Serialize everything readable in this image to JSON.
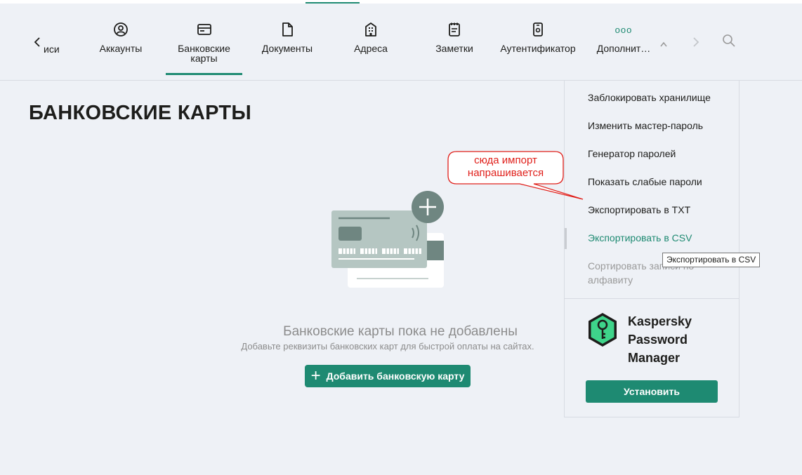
{
  "nav": {
    "partial_tab_label": "иси",
    "tabs": [
      {
        "label": "Аккаунты",
        "icon": "user-circle-icon"
      },
      {
        "label": "Банковские карты",
        "icon": "credit-card-icon"
      },
      {
        "label": "Документы",
        "icon": "document-icon"
      },
      {
        "label": "Адреса",
        "icon": "building-icon"
      },
      {
        "label": "Заметки",
        "icon": "notepad-icon"
      },
      {
        "label": "Аутентификатор",
        "icon": "phone-auth-icon"
      },
      {
        "label": "Дополнит…",
        "icon": "more-dots-icon",
        "dots": "ooo"
      }
    ]
  },
  "page": {
    "title": "БАНКОВСКИЕ КАРТЫ",
    "empty_title": "Банковские карты пока не добавлены",
    "empty_subtitle": "Добавьте реквизиты банковских карт для быстрой оплаты на сайтах.",
    "add_button": "Добавить банковскую карту",
    "add_button_plus": "+"
  },
  "dropdown": {
    "items": [
      "Заблокировать хранилище",
      "Изменить мастер-пароль",
      "Генератор паролей",
      "Показать слабые пароли",
      "Экспортировать в TXT",
      "Экспортировать в CSV",
      "Сортировать записи по алфавиту"
    ],
    "promo": {
      "line1": "Kaspersky",
      "line2": "Password",
      "line3": "Manager",
      "install_button": "Установить"
    }
  },
  "tooltip": "Экспортировать в CSV",
  "callout": {
    "line1": "сюда импорт",
    "line2": "напрашивается"
  },
  "colors": {
    "accent": "#1e8a72",
    "background": "#eef1f6",
    "callout": "#e0201b"
  }
}
